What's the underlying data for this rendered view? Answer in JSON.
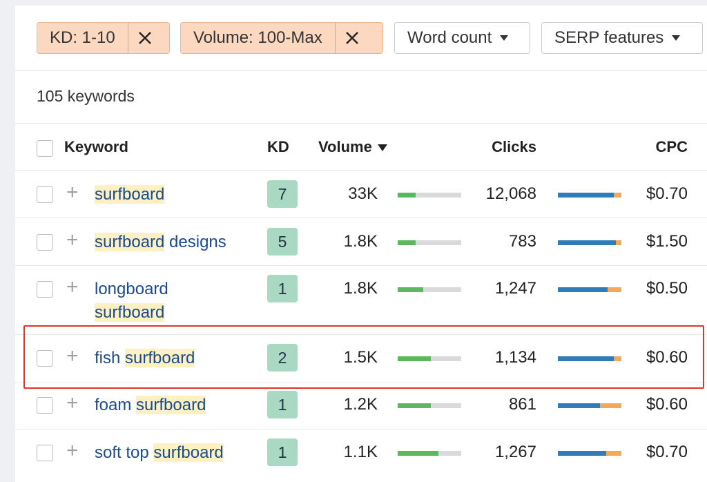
{
  "filters": {
    "kd_chip": "KD: 1-10",
    "volume_chip": "Volume: 100-Max",
    "word_count": "Word count",
    "serp_features": "SERP features"
  },
  "summary": {
    "count": "105 keywords"
  },
  "table": {
    "columns": {
      "keyword": "Keyword",
      "kd": "KD",
      "volume": "Volume",
      "clicks": "Clicks",
      "cpc": "CPC"
    },
    "rows": [
      {
        "kw_pre": "",
        "kw_hl": "surfboard",
        "kw_post": "",
        "kd": "7",
        "volume": "33K",
        "vol_frac": 0.28,
        "clicks": "12,068",
        "clicks_paid_frac": 0.88,
        "cpc": "$0.70"
      },
      {
        "kw_pre": "",
        "kw_hl": "surfboard",
        "kw_post": " designs",
        "kd": "5",
        "volume": "1.8K",
        "vol_frac": 0.28,
        "clicks": "783",
        "clicks_paid_frac": 0.91,
        "cpc": "$1.50"
      },
      {
        "kw_pre": "longboard ",
        "kw_hl": "surfboard",
        "kw_post": "",
        "kd": "1",
        "volume": "1.8K",
        "vol_frac": 0.4,
        "clicks": "1,247",
        "clicks_paid_frac": 0.78,
        "cpc": "$0.50"
      },
      {
        "kw_pre": "fish ",
        "kw_hl": "surfboard",
        "kw_post": "",
        "kd": "2",
        "volume": "1.5K",
        "vol_frac": 0.52,
        "clicks": "1,134",
        "clicks_paid_frac": 0.88,
        "cpc": "$0.60"
      },
      {
        "kw_pre": "foam ",
        "kw_hl": "surfboard",
        "kw_post": "",
        "kd": "1",
        "volume": "1.2K",
        "vol_frac": 0.52,
        "clicks": "861",
        "clicks_paid_frac": 0.66,
        "cpc": "$0.60"
      },
      {
        "kw_pre": "soft top ",
        "kw_hl": "surfboard",
        "kw_post": "",
        "kd": "1",
        "volume": "1.1K",
        "vol_frac": 0.64,
        "clicks": "1,267",
        "clicks_paid_frac": 0.76,
        "cpc": "$0.70"
      }
    ]
  },
  "colors": {
    "volume_bar": "#5cb85c",
    "clicks_organic": "#2f7cb8",
    "clicks_paid": "#f5a85a",
    "kd_badge": "#a9d9c3",
    "highlight_border": "#e0342a"
  },
  "icons": {
    "remove_filter": "close-icon",
    "dropdown": "caret-down-icon",
    "add_keyword": "plus-icon",
    "sort": "sort-desc-icon"
  }
}
